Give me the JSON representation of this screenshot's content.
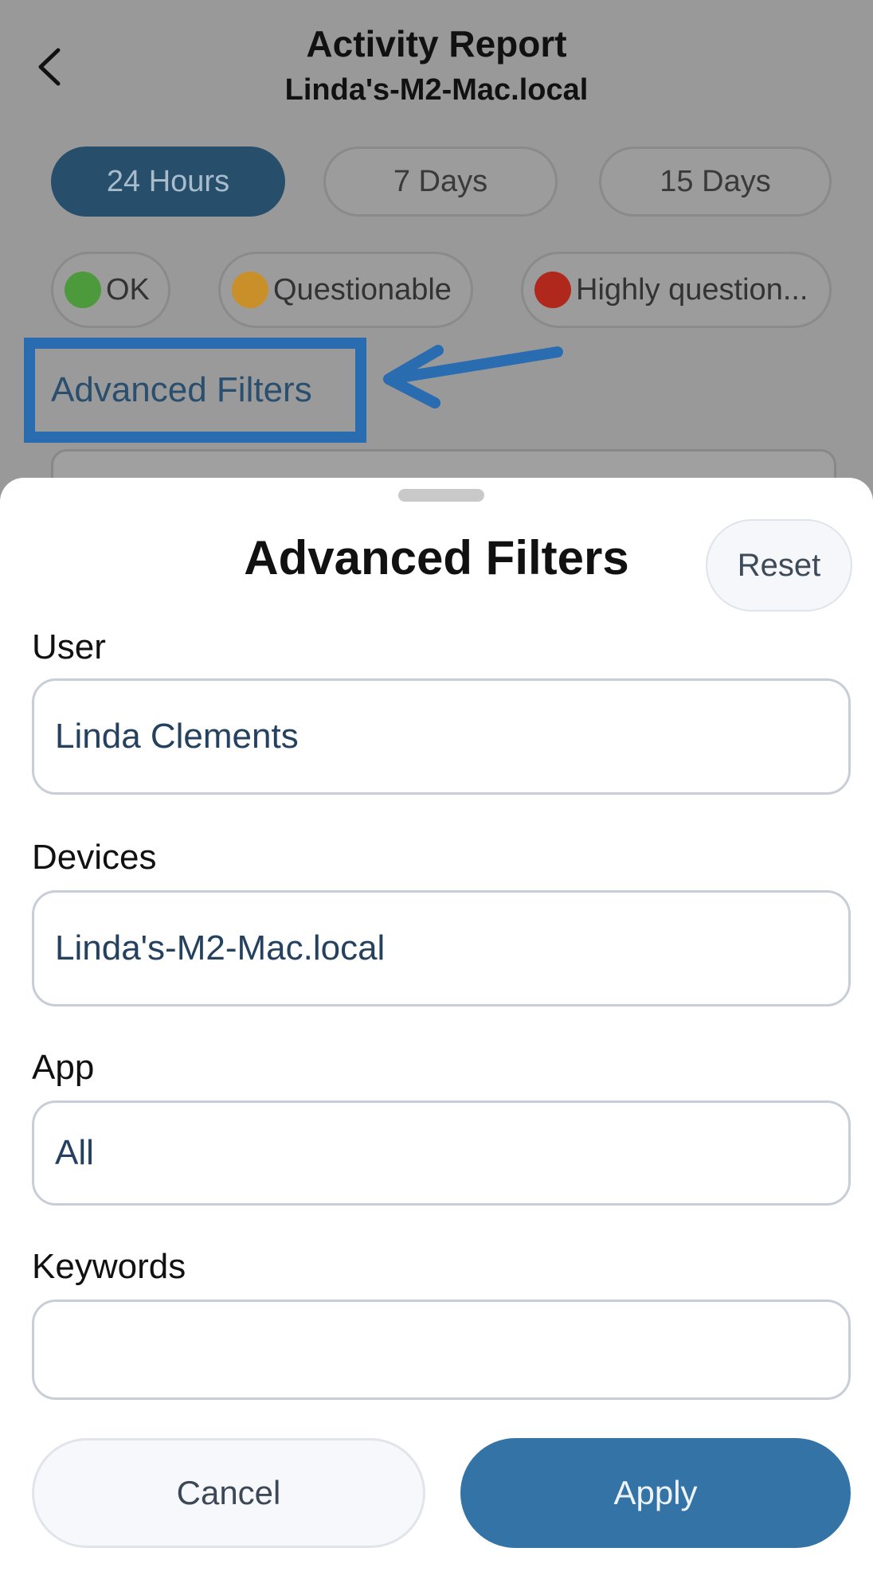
{
  "header": {
    "title": "Activity Report",
    "subtitle": "Linda's-M2-Mac.local"
  },
  "time_ranges": [
    {
      "label": "24 Hours",
      "active": true
    },
    {
      "label": "7 Days",
      "active": false
    },
    {
      "label": "15 Days",
      "active": false
    }
  ],
  "status_filters": [
    {
      "label": "OK",
      "color": "#4d9a3c"
    },
    {
      "label": "Questionable",
      "color": "#c9902a"
    },
    {
      "label": "Highly question...",
      "color": "#b0271b"
    }
  ],
  "advanced_filters_link": "Advanced Filters",
  "sheet": {
    "title": "Advanced Filters",
    "reset_label": "Reset",
    "fields": {
      "user": {
        "label": "User",
        "value": "Linda Clements"
      },
      "devices": {
        "label": "Devices",
        "value": "Linda's-M2-Mac.local"
      },
      "app": {
        "label": "App",
        "value": "All"
      },
      "keywords": {
        "label": "Keywords",
        "value": ""
      }
    },
    "cancel_label": "Cancel",
    "apply_label": "Apply"
  },
  "colors": {
    "accent": "#3473a6",
    "highlight_box": "#2a6cb0"
  }
}
